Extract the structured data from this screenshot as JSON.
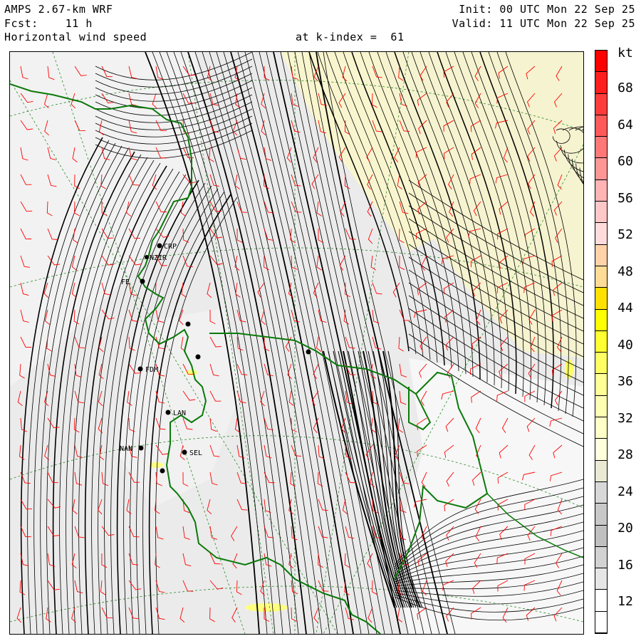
{
  "header": {
    "model": "AMPS 2.67-km WRF",
    "fcst_label": "Fcst:",
    "fcst_value": "11 h",
    "field": "Horizontal wind speed",
    "level": "at k-index =  61",
    "init": "Init: 00 UTC Mon 22 Sep 25",
    "valid": "Valid: 11 UTC Mon 22 Sep 25"
  },
  "colorbar": {
    "unit": "kt",
    "labels": [
      "68",
      "64",
      "60",
      "56",
      "52",
      "48",
      "44",
      "40",
      "36",
      "32",
      "28",
      "24",
      "20",
      "16",
      "12"
    ],
    "colors": [
      "#ffffff",
      "#ffffff",
      "#e6e6e6",
      "#d2d2d2",
      "#c0c0c0",
      "#c8c8c8",
      "#d8d8d8",
      "#e9e9d4",
      "#ffffdc",
      "#ffffc8",
      "#ffffb4",
      "#ffff96",
      "#ffff64",
      "#ffff32",
      "#ffff00",
      "#ffe100",
      "#ffdc96",
      "#ffd2aa",
      "#ffdcdc",
      "#ffc8c8",
      "#ffb4b4",
      "#ff9696",
      "#ff7878",
      "#ff5a5a",
      "#ff3c3c",
      "#ff1e1e",
      "#ff0000"
    ]
  },
  "stations": [
    {
      "name": "CRP"
    },
    {
      "name": "NZIR"
    },
    {
      "name": "FE"
    },
    {
      "name": "FDM"
    },
    {
      "name": "LAN"
    },
    {
      "name": "NAN"
    },
    {
      "name": "SEL"
    }
  ],
  "colors": {
    "streamline": "#000000",
    "barb": "#ff0000",
    "coast": "#0a7a0a",
    "grid": "#2e8b2e"
  }
}
